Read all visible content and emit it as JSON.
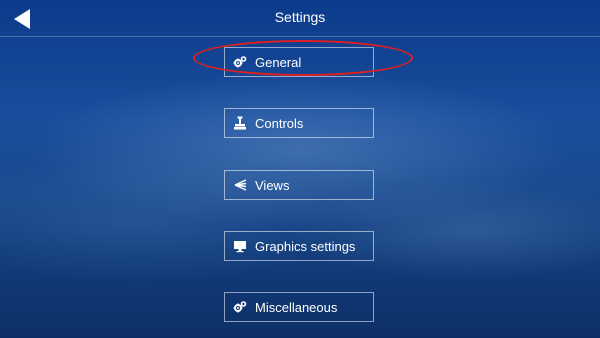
{
  "header": {
    "title": "Settings",
    "back_icon": "back-arrow-icon"
  },
  "menu": [
    {
      "label": "General",
      "icon": "gears-icon"
    },
    {
      "label": "Controls",
      "icon": "joystick-icon"
    },
    {
      "label": "Views",
      "icon": "views-icon"
    },
    {
      "label": "Graphics settings",
      "icon": "monitor-icon"
    },
    {
      "label": "Miscellaneous",
      "icon": "gears-icon"
    }
  ],
  "colors": {
    "text": "#ffffff",
    "highlight": "#e0201e"
  }
}
